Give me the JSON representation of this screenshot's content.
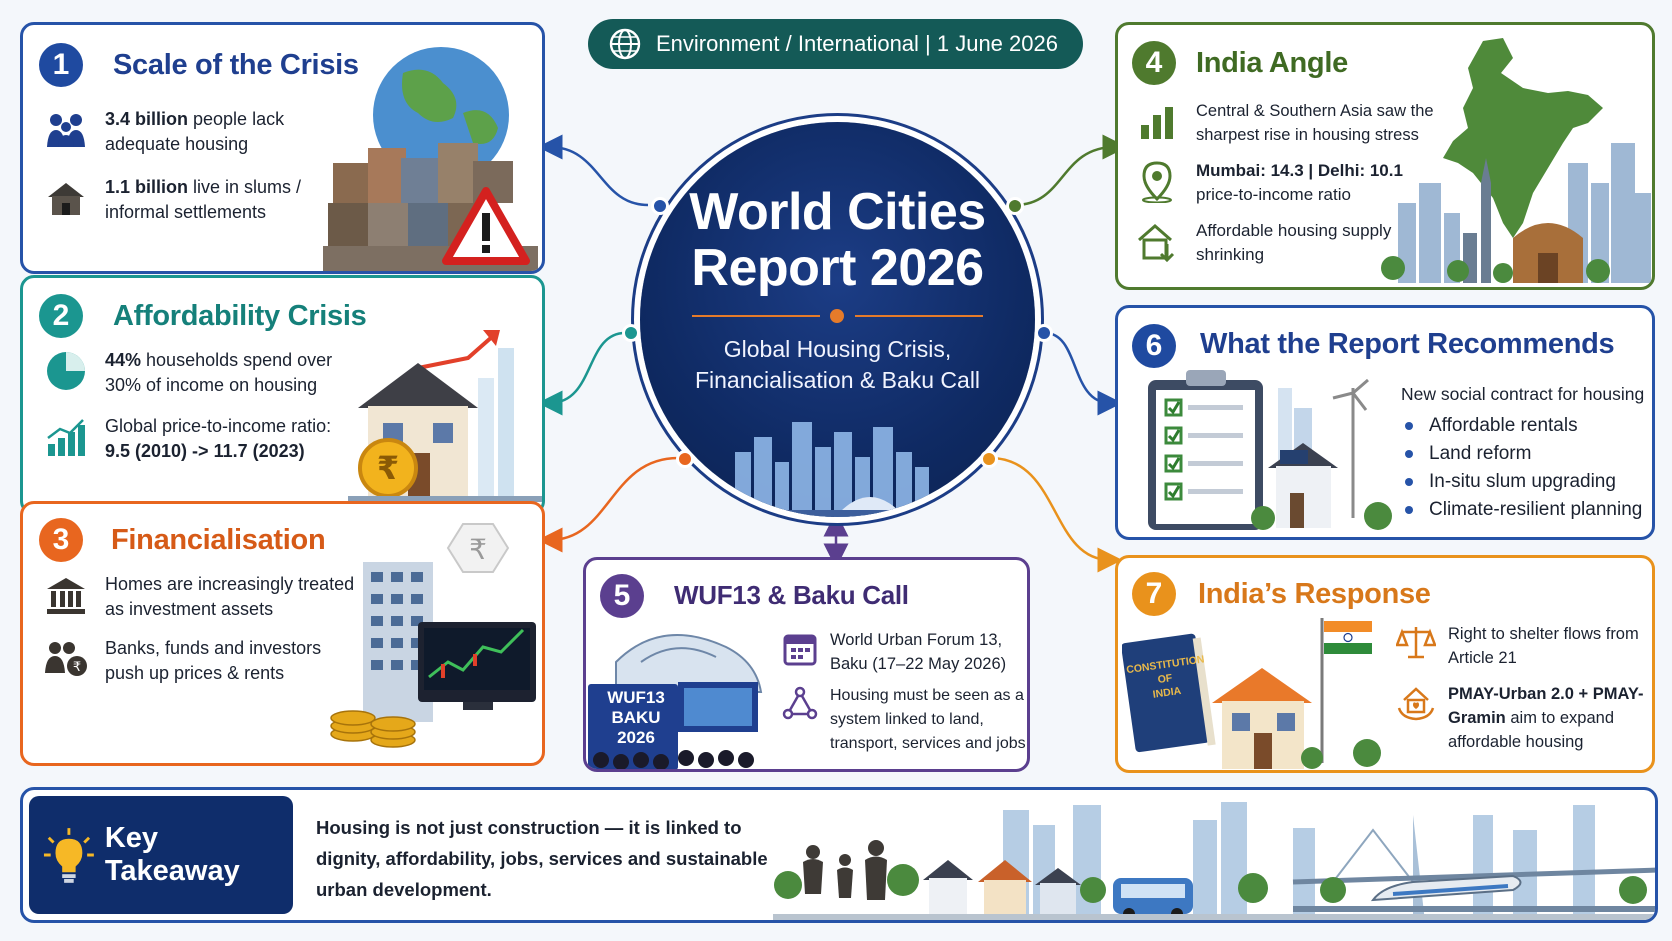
{
  "header_pill": "Environment / International | 1 June 2026",
  "hub": {
    "title_line1": "World Cities",
    "title_line2": "Report 2026",
    "subtitle_line1": "Global Housing Crisis,",
    "subtitle_line2": "Financialisation & Baku Call"
  },
  "cards": {
    "c1": {
      "number": "1",
      "title": "Scale of the Crisis",
      "r1_bold": "3.4 billion",
      "r1_text": " people lack adequate housing",
      "r2_bold": "1.1 billion",
      "r2_text": " live in slums / informal settlements"
    },
    "c2": {
      "number": "2",
      "title": "Affordability Crisis",
      "r1_bold": "44%",
      "r1_text": " households spend over 30% of income on housing",
      "r2_text": "Global price-to-income ratio:",
      "r2_bold": "9.5 (2010) -> 11.7 (2023)"
    },
    "c3": {
      "number": "3",
      "title": "Financialisation",
      "r1_text": "Homes are increasingly treated as investment assets",
      "r2_text": "Banks, funds and investors push up prices & rents",
      "rupee_symbol": "₹"
    },
    "c4": {
      "number": "4",
      "title": "India Angle",
      "r1_text": "Central & Southern Asia saw the sharpest rise in housing stress",
      "r2_bold": "Mumbai: 14.3 | Delhi: 10.1",
      "r2_text": "price-to-income ratio",
      "r3_text": "Affordable housing supply shrinking"
    },
    "c5": {
      "number": "5",
      "title": "WUF13 & Baku Call",
      "sign_line1": "WUF13",
      "sign_line2": "BAKU",
      "sign_line3": "2026",
      "r1_text": "World Urban Forum 13, Baku (17–22 May 2026)",
      "r2_text": "Housing must be seen as a system linked to land, transport, services and jobs"
    },
    "c6": {
      "number": "6",
      "title": "What the Report Recommends",
      "intro": "New social contract for housing",
      "items": [
        "Affordable rentals",
        "Land reform",
        "In-situ slum upgrading",
        "Climate-resilient planning"
      ]
    },
    "c7": {
      "number": "7",
      "title": "India’s Response",
      "book_line1": "CONSTITUTION",
      "book_line2": "OF",
      "book_line3": "INDIA",
      "r1_text": "Right to shelter flows from Article 21",
      "r2_bold": "PMAY-Urban 2.0 + PMAY-Gramin",
      "r2_text": " aim to expand affordable housing"
    }
  },
  "takeaway": {
    "label": "Key Takeaway",
    "text": "Housing is not just construction — it is linked to dignity, affordability, jobs, services and sustainable urban development."
  },
  "colors": {
    "blue": "#2653a8",
    "teal": "#1b9690",
    "orange": "#e8661f",
    "green": "#4f7a2e",
    "purple": "#5b3f8f",
    "amber": "#e9921c",
    "navy": "#0f2d6b"
  }
}
